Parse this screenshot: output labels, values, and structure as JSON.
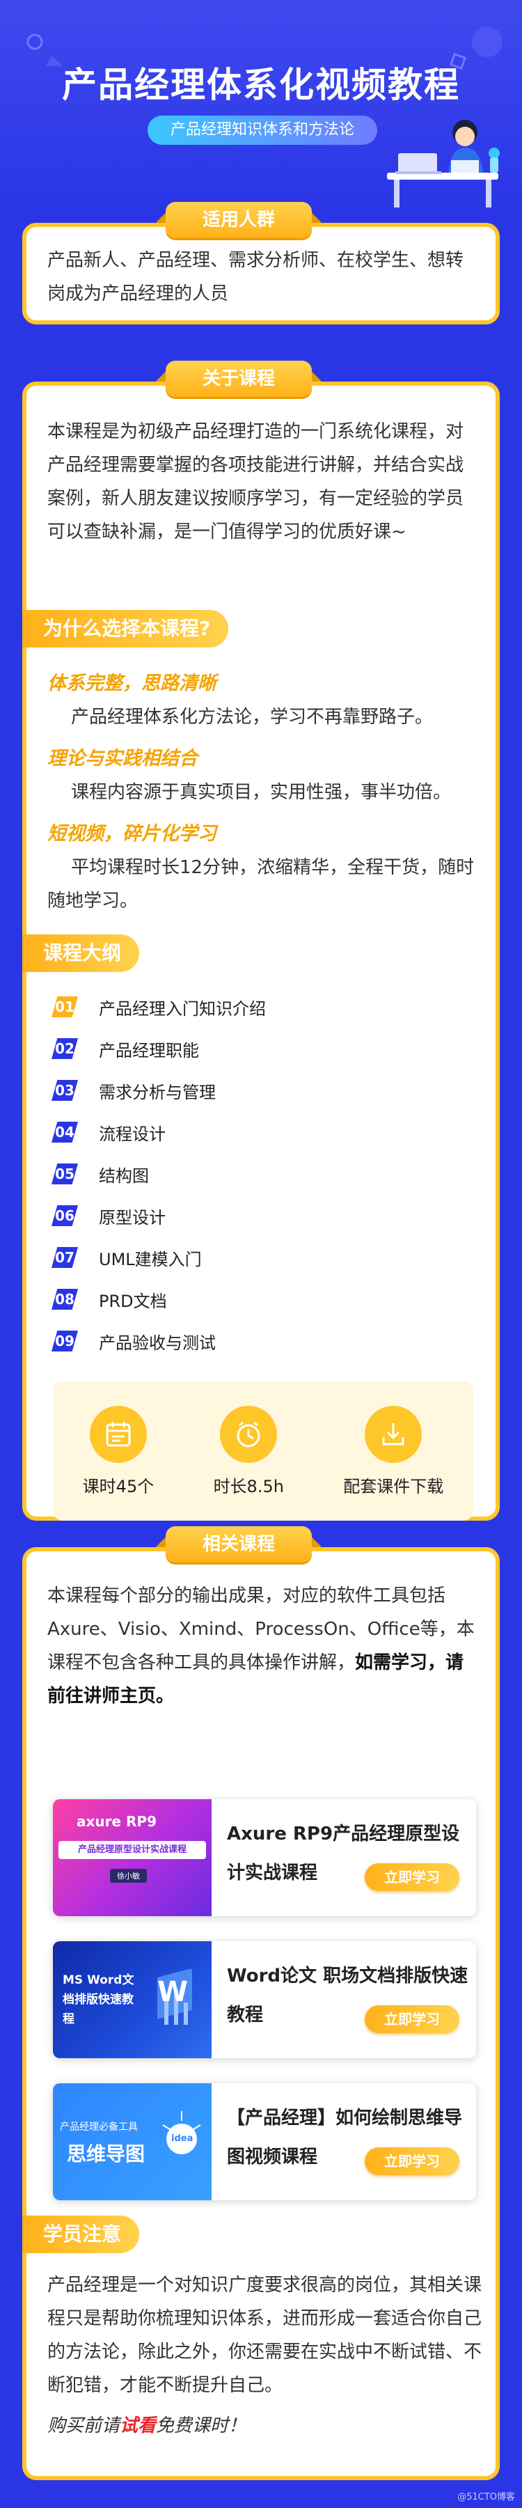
{
  "hero": {
    "title": "产品经理体系化视频教程",
    "subtitle": "产品经理知识体系和方法论"
  },
  "audience": {
    "ribbon": "适用人群",
    "text": "产品新人、产品经理、需求分析师、在校学生、想转岗成为产品经理的人员"
  },
  "about": {
    "ribbon": "关于课程",
    "text": "本课程是为初级产品经理打造的一门系统化课程，对产品经理需要掌握的各项技能进行讲解，并结合实战案例，新人朋友建议按顺序学习，有一定经验的学员可以查缺补漏，是一门值得学习的优质好课~",
    "why_tag": "为什么选择本课程?",
    "features": [
      {
        "title": "体系完整，思路清晰",
        "desc": "产品经理体系化方法论，学习不再靠野路子。"
      },
      {
        "title": "理论与实践相结合",
        "desc": "课程内容源于真实项目，实用性强，事半功倍。"
      },
      {
        "title": "短视频，碎片化学习",
        "desc": "平均课程时长12分钟，浓缩精华，全程干货，随时随地学习。"
      }
    ],
    "outline_tag": "课程大纲",
    "outline": [
      {
        "num": "01",
        "label": "产品经理入门知识介绍"
      },
      {
        "num": "02",
        "label": "产品经理职能"
      },
      {
        "num": "03",
        "label": "需求分析与管理"
      },
      {
        "num": "04",
        "label": "流程设计"
      },
      {
        "num": "05",
        "label": "结构图"
      },
      {
        "num": "06",
        "label": "原型设计"
      },
      {
        "num": "07",
        "label": "UML建模入门"
      },
      {
        "num": "08",
        "label": "PRD文档"
      },
      {
        "num": "09",
        "label": "产品验收与测试"
      }
    ],
    "stats": [
      {
        "icon": "calendar-icon",
        "label": "课时45个"
      },
      {
        "icon": "clock-icon",
        "label": "时长8.5h"
      },
      {
        "icon": "download-icon",
        "label": "配套课件下载"
      }
    ]
  },
  "related": {
    "ribbon": "相关课程",
    "intro_normal": "本课程每个部分的输出成果，对应的软件工具包括Axure、Visio、Xmind、ProcessOn、Office等，本课程不包含各种工具的具体操作讲解，",
    "intro_bold": "如需学习，请前往讲师主页。",
    "courses": [
      {
        "name": "Axure RP9产品经理原型设计实战课程",
        "button": "立即学习",
        "thumb_brand": "axure RP9",
        "thumb_title": "产品经理原型设计实战课程",
        "thumb_sub": "徐小敏"
      },
      {
        "name": "Word论文 职场文档排版快速教程",
        "button": "立即学习",
        "thumb_title": "MS Word文档排版快速教程",
        "thumb_letter": "W"
      },
      {
        "name": "【产品经理】如何绘制思维导图视频课程",
        "button": "立即学习",
        "thumb_small": "产品经理必备工具",
        "thumb_title": "思维导图",
        "thumb_idea": "idea"
      }
    ]
  },
  "notice": {
    "tag": "学员注意",
    "text": "产品经理是一个对知识广度要求很高的岗位，其相关课程只是帮助你梳理知识体系，进而形成一套适合你自己的方法论，除此之外，你还需要在实战中不断试错、不断犯错，才能不断提升自己。",
    "cta_before": "购买前请",
    "cta_highlight": "试看",
    "cta_after": "免费课时！"
  },
  "watermark": "@51CTO博客",
  "colors": {
    "background": "#2a36e6",
    "accent_yellow": "#ffc62a",
    "feature_orange": "#f5a300",
    "highlight_red": "#e8262a"
  }
}
